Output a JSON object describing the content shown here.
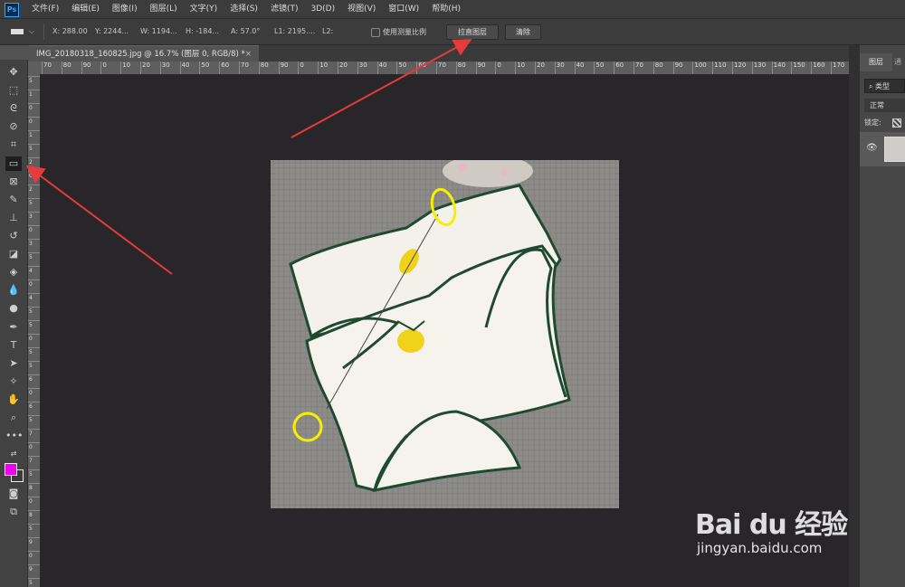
{
  "app": {
    "logo": "Ps"
  },
  "menu": [
    "文件(F)",
    "编辑(E)",
    "图像(I)",
    "图层(L)",
    "文字(Y)",
    "选择(S)",
    "滤镜(T)",
    "3D(D)",
    "视图(V)",
    "窗口(W)",
    "帮助(H)"
  ],
  "options": {
    "tool_icon": "ruler-icon",
    "x": "X: 288.00",
    "y": "Y: 2244...",
    "w": "W: 1194...",
    "h": "H: -184...",
    "a": "A: 57.0°",
    "l1": "L1: 2195....",
    "l2": "L2:",
    "use_scale_label": "使用测量比例",
    "straighten_label": "拉直图层",
    "clear_label": "清除"
  },
  "document_tab": {
    "title": "IMG_20180318_160825.jpg @ 16.7% (图层 0, RGB/8) *",
    "close": "×"
  },
  "ruler": {
    "h_labels": [
      "70",
      "80",
      "90",
      "0",
      "10",
      "20",
      "30",
      "40",
      "50",
      "60",
      "70",
      "80",
      "90",
      "0",
      "10",
      "20",
      "30",
      "40",
      "50",
      "60",
      "70",
      "80",
      "90",
      "0",
      "10",
      "20",
      "30",
      "40",
      "50",
      "60",
      "70",
      "80",
      "90",
      "100",
      "110",
      "120",
      "130",
      "140",
      "150",
      "160",
      "170"
    ],
    "v_labels": [
      "5",
      "1",
      "0",
      "0",
      "1",
      "5",
      "2",
      "0",
      "2",
      "5",
      "3",
      "0",
      "3",
      "5",
      "4",
      "0",
      "4",
      "5",
      "5",
      "0",
      "5",
      "5",
      "6",
      "0",
      "6",
      "5",
      "7",
      "0",
      "7",
      "5",
      "8",
      "0",
      "8",
      "5",
      "9",
      "0",
      "9",
      "5"
    ]
  },
  "tools": [
    "move-icon",
    "marquee-icon",
    "lasso-icon",
    "quick-select-icon",
    "crop-icon",
    "ruler-icon",
    "frame-icon",
    "brush-icon",
    "stamp-icon",
    "history-brush-icon",
    "eraser-icon",
    "bucket-icon",
    "blur-icon",
    "dodge-icon",
    "pen-icon",
    "type-icon",
    "path-select-icon",
    "shape-icon",
    "hand-icon",
    "zoom-icon",
    "more-icon"
  ],
  "colors": {
    "foreground": "#ee00ee",
    "background": "#3a3a3a",
    "arrow": "#e63b3b",
    "highlight": "#f5f000"
  },
  "layers_panel": {
    "tab": "图层",
    "tab2": "通",
    "search": "⌕ 类型",
    "blend_mode": "正常",
    "lock_label": "锁定:",
    "eye": "👁"
  },
  "watermark": {
    "brand": "Bai du 经验",
    "url": "jingyan.baidu.com"
  }
}
